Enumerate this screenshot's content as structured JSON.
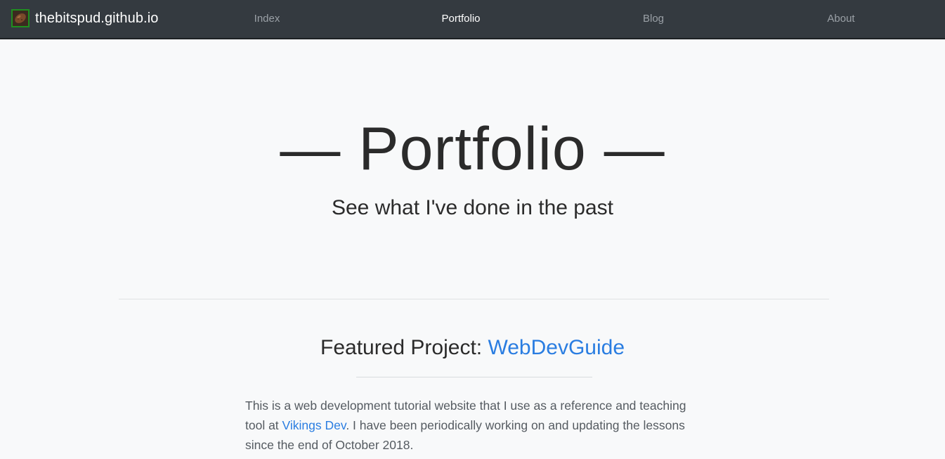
{
  "navbar": {
    "brand": "thebitspud.github.io",
    "brand_logo_icon": "potato-icon",
    "links": [
      {
        "label": "Index",
        "active": false
      },
      {
        "label": "Portfolio",
        "active": true
      },
      {
        "label": "Blog",
        "active": false
      },
      {
        "label": "About",
        "active": false
      }
    ]
  },
  "hero": {
    "title": "— Portfolio —",
    "subtitle": "See what I've done in the past"
  },
  "featured": {
    "prefix": "Featured Project: ",
    "link_label": "WebDevGuide"
  },
  "description": {
    "text_before": "This is a web development tutorial website that I use as a reference and teaching tool at ",
    "link_label": "Vikings Dev",
    "text_after": ". I have been periodically working on and updating the lessons since the end of October 2018."
  },
  "colors": {
    "navbar_bg": "#343a40",
    "page_bg": "#f8f9fa",
    "link": "#2a7de1"
  }
}
